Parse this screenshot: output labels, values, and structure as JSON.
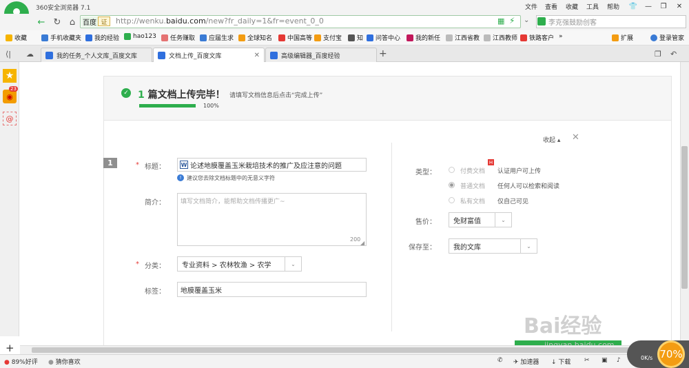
{
  "browser": {
    "name": "360安全浏览器 7.1",
    "menu": [
      "文件",
      "查看",
      "收藏",
      "工具",
      "帮助"
    ],
    "window_buttons": [
      "shirt",
      "minimize",
      "restore",
      "close"
    ]
  },
  "address_bar": {
    "site_tag": "百度",
    "cert_tag": "证",
    "url_prefix": "http://wenku.",
    "url_domain": "baidu.com",
    "url_path": "/new?fr_daily=1&fr=event_0_0",
    "search_placeholder": "李克强鼓励创客"
  },
  "bookmarks": [
    {
      "label": "收藏",
      "color": "#f6b400"
    },
    {
      "label": "手机收藏夹",
      "color": "#3a7bd5"
    },
    {
      "label": "我的经验",
      "color": "#2f6fde"
    },
    {
      "label": "hao123",
      "color": "#2eae4d"
    },
    {
      "label": "任务赚取",
      "color": "#e57373"
    },
    {
      "label": "应届生求",
      "color": "#3a7bd5"
    },
    {
      "label": "全球知名",
      "color": "#f39c12"
    },
    {
      "label": "中国高等",
      "color": "#e53935"
    },
    {
      "label": "支付宝",
      "color": "#f39c12"
    },
    {
      "label": "知",
      "color": "#555555"
    },
    {
      "label": "问答中心",
      "color": "#2f6fde"
    },
    {
      "label": "我的新任",
      "color": "#c2185b"
    },
    {
      "label": "江西省教",
      "color": "#bbbbbb"
    },
    {
      "label": "江西教师",
      "color": "#bbbbbb"
    },
    {
      "label": "铁路客户",
      "color": "#e53935"
    }
  ],
  "bookmarks_right": {
    "extend": "扩展",
    "login": "登录管家"
  },
  "tabs": [
    {
      "label": "我的任务_个人文库_百度文库",
      "active": false
    },
    {
      "label": "文档上传_百度文库",
      "active": true
    },
    {
      "label": "高级编辑器_百度经验",
      "active": false
    }
  ],
  "sidebar": {
    "badge": "23"
  },
  "upload": {
    "count": "1",
    "title_suffix": "篇文档上传完毕！",
    "hint": "请填写文档信息后点击“完成上传”",
    "progress": 1.0,
    "progress_label": "100%",
    "collapse": "收起",
    "doc_number": "1"
  },
  "form": {
    "title_label": "标题：",
    "title_value": "论述地膜覆盖玉米栽培技术的推广及应注意的问题",
    "title_hint": "建议您去除文档标题中的无意义字符",
    "intro_label": "简介：",
    "intro_placeholder": "填写文档简介，能帮助文档传播更广~",
    "intro_count": "200",
    "category_label": "分类：",
    "category_value": "专业资料 > 农林牧渔 > 农学",
    "tag_label": "标签：",
    "tag_value": "地膜覆盖玉米",
    "type_label": "类型：",
    "type_options": [
      {
        "name": "付费文档",
        "desc": "认证用户可上传",
        "badge": "H",
        "selected": false
      },
      {
        "name": "普通文档",
        "desc": "任何人可以检索和阅读",
        "selected": true
      },
      {
        "name": "私有文档",
        "desc": "仅自己可见",
        "selected": false
      }
    ],
    "price_label": "售价：",
    "price_value": "免财富值",
    "save_label": "保存至：",
    "save_value": "我的文库"
  },
  "statusbar": {
    "rating": "89%好评",
    "guess": "猜你喜欢",
    "accelerator": "加速器",
    "download": "下载",
    "speed_label": "0K/s",
    "speed_pct": "70%"
  },
  "watermark": {
    "main": "Bai经验",
    "sub": "jingyan.baidu.com"
  }
}
